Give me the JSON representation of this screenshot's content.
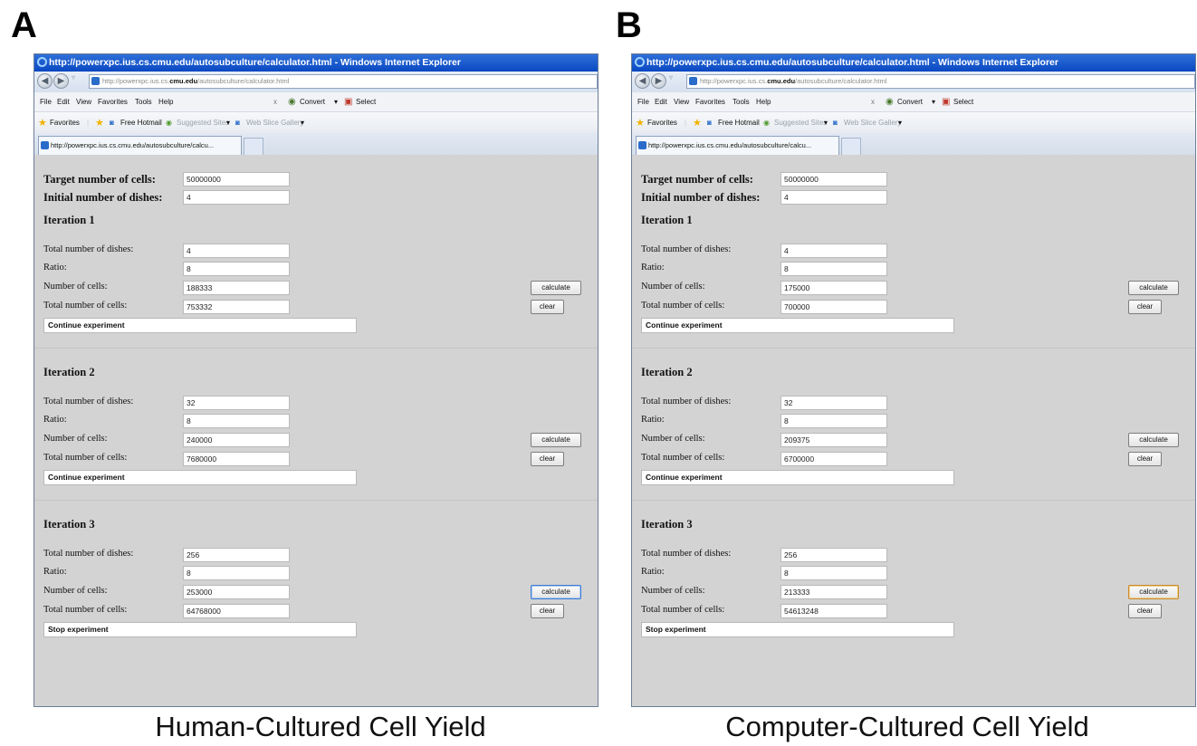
{
  "figure": {
    "panel_a_letter": "A",
    "panel_b_letter": "B",
    "panel_a_caption": "Human-Cultured Cell Yield",
    "panel_b_caption": "Computer-Cultured Cell Yield"
  },
  "browser": {
    "window_title": "http://powerxpc.ius.cs.cmu.edu/autosubculture/calculator.html - Windows Internet Explorer",
    "url_prefix": "http://powerxpc.ius.cs.",
    "url_domain": "cmu.edu",
    "url_suffix": "/autosubculture/calculator.html",
    "menu": {
      "file": "File",
      "edit": "Edit",
      "view": "View",
      "favorites": "Favorites",
      "tools": "Tools",
      "help": "Help"
    },
    "toolbar": {
      "close_x": "x",
      "convert": "Convert",
      "select": "Select",
      "dropdown_arrow": "▾"
    },
    "favbar": {
      "favorites": "Favorites",
      "free_hotmail": "Free Hotmail",
      "suggested_sites": "Suggested Sites",
      "web_slice_gallery": "Web Slice Gallery",
      "dropdown_arrow": "▾"
    },
    "tab_title": "http://powerxpc.ius.cs.cmu.edu/autosubculture/calcu..."
  },
  "form_labels": {
    "target_cells": "Target number of cells:",
    "initial_dishes": "Initial number of dishes:",
    "total_dishes": "Total number of dishes:",
    "ratio": "Ratio:",
    "number_of_cells": "Number of cells:",
    "total_cells": "Total number of cells:",
    "calculate": "calculate",
    "clear": "clear"
  },
  "panels": {
    "a": {
      "target_cells": "50000000",
      "initial_dishes": "4",
      "iterations": [
        {
          "title": "Iteration 1",
          "total_dishes": "4",
          "ratio": "8",
          "number_of_cells": "188333",
          "total_cells": "753332",
          "status": "Continue experiment"
        },
        {
          "title": "Iteration 2",
          "total_dishes": "32",
          "ratio": "8",
          "number_of_cells": "240000",
          "total_cells": "7680000",
          "status": "Continue experiment"
        },
        {
          "title": "Iteration 3",
          "total_dishes": "256",
          "ratio": "8",
          "number_of_cells": "253000",
          "total_cells": "64768000",
          "status": "Stop experiment"
        }
      ]
    },
    "b": {
      "target_cells": "50000000",
      "initial_dishes": "4",
      "iterations": [
        {
          "title": "Iteration 1",
          "total_dishes": "4",
          "ratio": "8",
          "number_of_cells": "175000",
          "total_cells": "700000",
          "status": "Continue experiment"
        },
        {
          "title": "Iteration 2",
          "total_dishes": "32",
          "ratio": "8",
          "number_of_cells": "209375",
          "total_cells": "6700000",
          "status": "Continue experiment"
        },
        {
          "title": "Iteration 3",
          "total_dishes": "256",
          "ratio": "8",
          "number_of_cells": "213333",
          "total_cells": "54613248",
          "status": "Stop experiment"
        }
      ]
    }
  }
}
